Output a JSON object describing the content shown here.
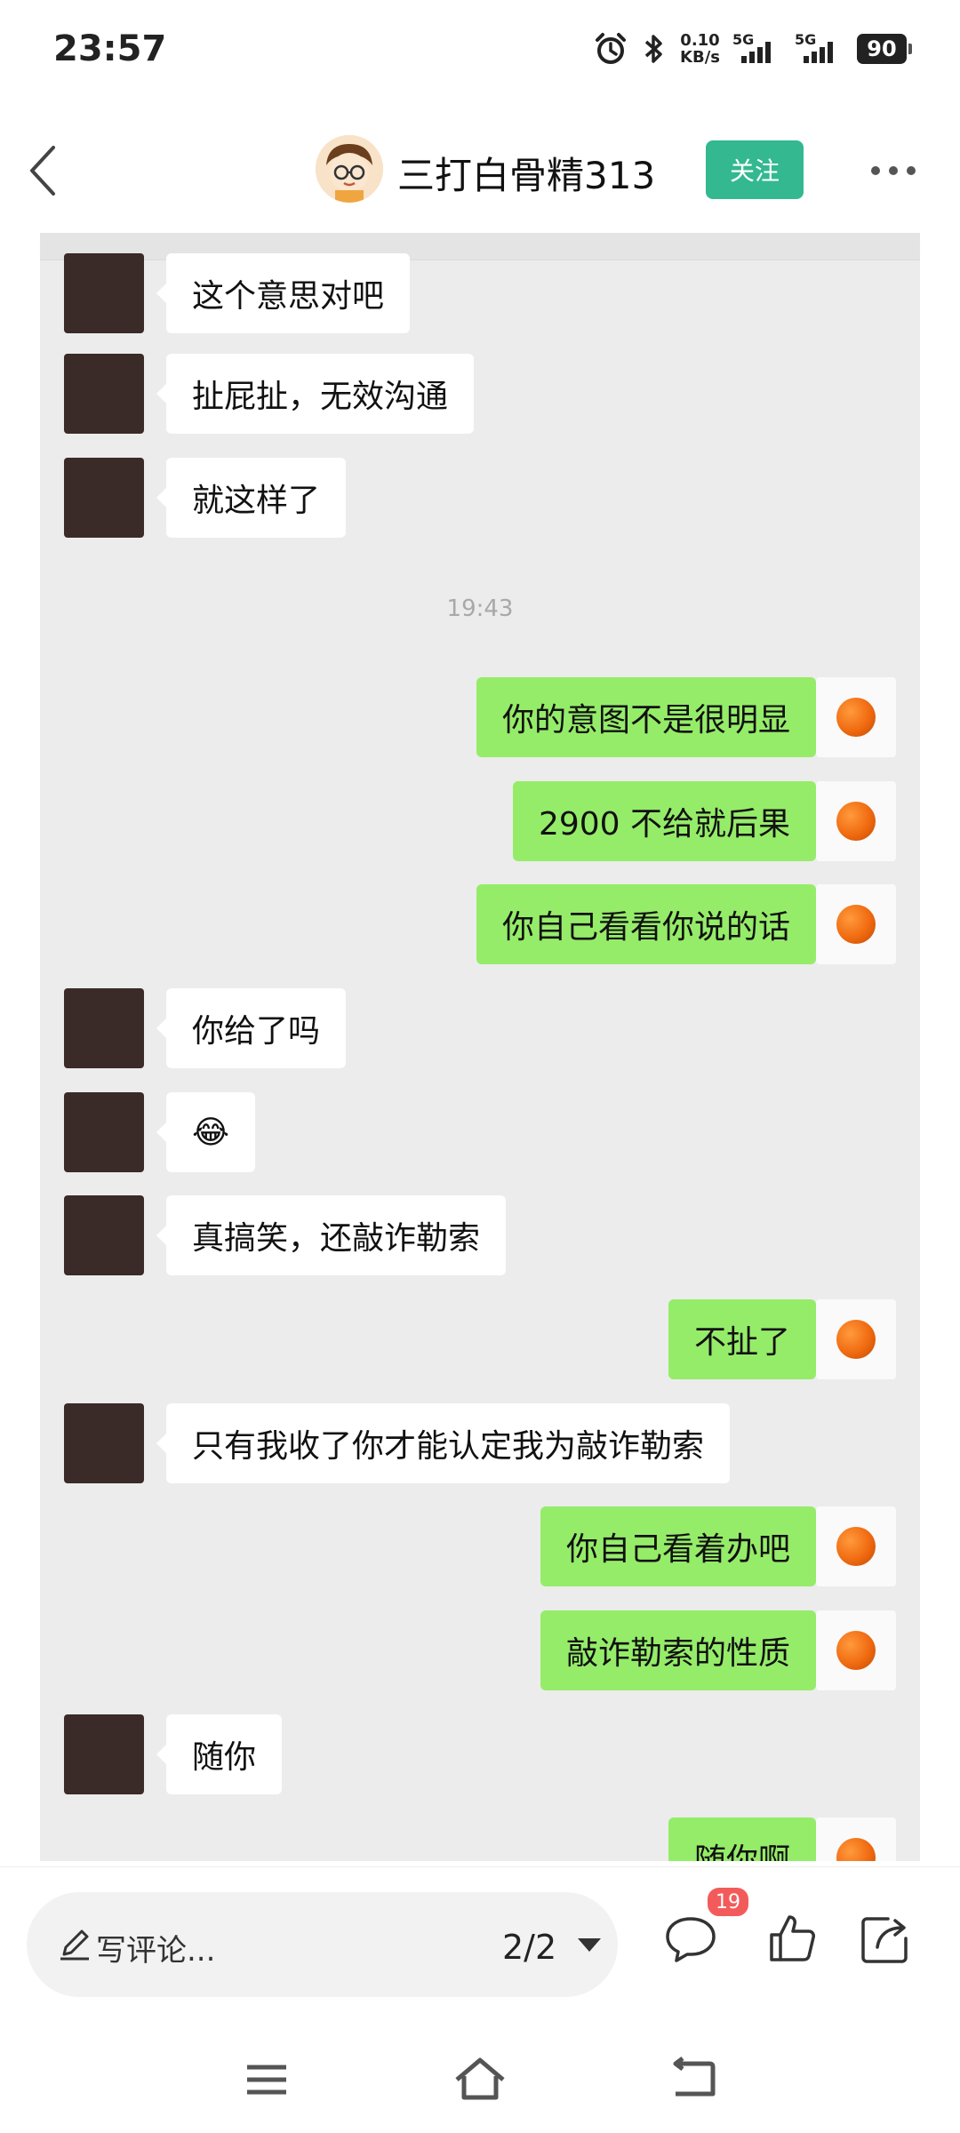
{
  "status_bar": {
    "time": "23:57",
    "net_speed_value": "0.10",
    "net_speed_unit": "KB/s",
    "sim1": "5G",
    "sim2": "5G",
    "battery": "90"
  },
  "header": {
    "title": "三打白骨精313",
    "follow_label": "关注",
    "icons": [
      "back-arrow-icon",
      "more-icon"
    ]
  },
  "chat": {
    "timestamp": "19:43",
    "messages": [
      {
        "side": "left",
        "text": "这个意思对吧"
      },
      {
        "side": "left",
        "text": "扯屁扯，无效沟通"
      },
      {
        "side": "left",
        "text": "就这样了"
      },
      {
        "side": "right",
        "text": "你的意图不是很明显"
      },
      {
        "side": "right",
        "text": "2900 不给就后果"
      },
      {
        "side": "right",
        "text": "你自己看看你说的话"
      },
      {
        "side": "left",
        "text": "你给了吗"
      },
      {
        "side": "left",
        "text": "😂"
      },
      {
        "side": "left",
        "text": "真搞笑，还敲诈勒索"
      },
      {
        "side": "right",
        "text": "不扯了"
      },
      {
        "side": "left",
        "text": "只有我收了你才能认定我为敲诈勒索"
      },
      {
        "side": "right",
        "text": "你自己看着办吧"
      },
      {
        "side": "right",
        "text": "敲诈勒索的性质"
      },
      {
        "side": "left",
        "text": "随你"
      },
      {
        "side": "right",
        "text": "随你啊"
      }
    ]
  },
  "bottom_bar": {
    "comment_placeholder": "写评论...",
    "page_indicator": "2/2",
    "comment_count": "19",
    "icons": [
      "pen-icon",
      "comment-icon",
      "thumbs-up-icon",
      "share-icon"
    ]
  },
  "nav_bar": {
    "icons": [
      "menu-icon",
      "home-icon",
      "back-icon"
    ]
  },
  "colors": {
    "accent_follow": "#33b890",
    "bubble_self": "#95ec69",
    "bubble_other": "#ffffff",
    "chat_background": "#ececec",
    "badge": "#f35b5b"
  }
}
